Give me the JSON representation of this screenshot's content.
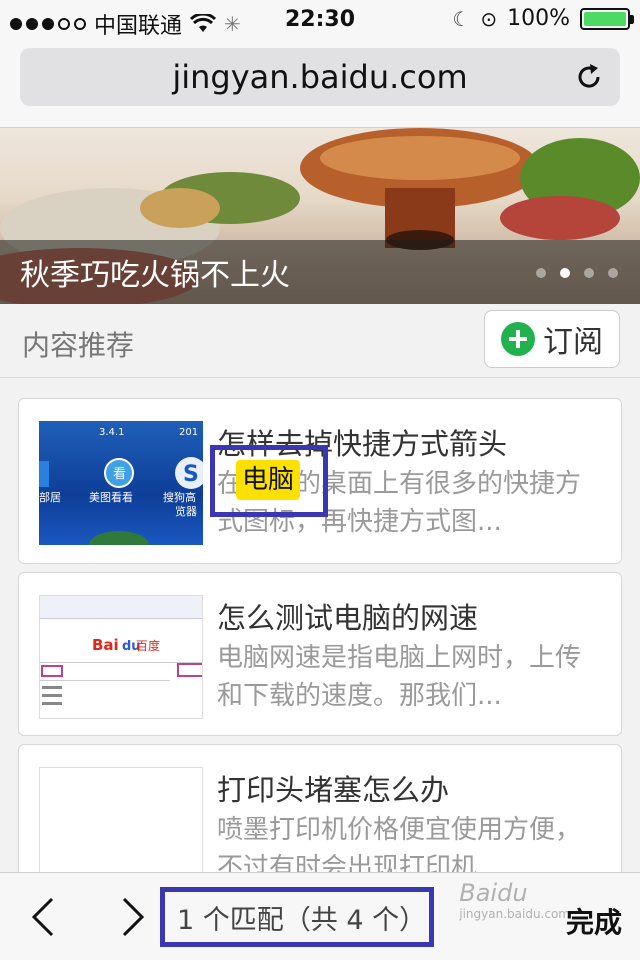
{
  "status": {
    "carrier": "中国联通",
    "time": "22:30",
    "battery": "100%",
    "battery_level": 1.0
  },
  "browser": {
    "url": "jingyan.baidu.com"
  },
  "banner": {
    "title": "秋季巧吃火锅不上火",
    "pages": 4,
    "active_page": 2
  },
  "section": {
    "title": "内容推荐",
    "subscribe_label": "订阅"
  },
  "articles": [
    {
      "title": "怎样去掉快捷方式箭头",
      "desc": "在电脑的桌面上有很多的快捷方式图标，再快捷方式图...",
      "thumb_text": [
        "3.4.1",
        "201",
        "美图看看",
        "搜狗高",
        "部居",
        "览器"
      ]
    },
    {
      "title": "怎么测试电脑的网速",
      "desc": "电脑网速是指电脑上网时，上传和下载的速度。那我们...",
      "thumb_text": [
        "Bai",
        "du",
        "百度"
      ]
    },
    {
      "title": "打印头堵塞怎么办",
      "desc": "喷墨打印机价格便宜使用方便，不过有时会出现打印机..."
    }
  ],
  "find": {
    "highlight_word": "电脑",
    "match_text": "1 个匹配（共 4 个）",
    "done_label": "完成"
  },
  "watermark": {
    "text": "Baidu",
    "sub": "jingyan.baidu.com"
  },
  "colors": {
    "highlight_yellow": "#fbe000",
    "annotation_border": "#3a37b0",
    "subscribe_green": "#22b14c",
    "battery_green": "#4cd964"
  }
}
